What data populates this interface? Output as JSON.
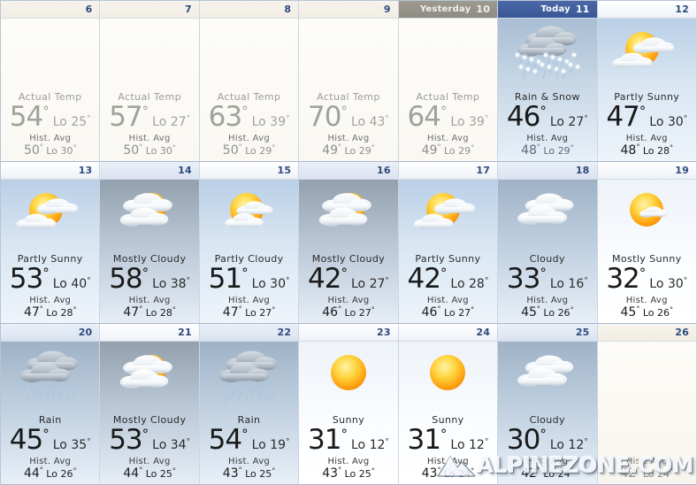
{
  "watermark": {
    "text": "ALPINEZONE.COM",
    "icon": "mountain-logo-icon"
  },
  "labels": {
    "actual_temp": "Actual Temp",
    "hist_avg": "Hist. Avg",
    "lo": "Lo",
    "degree": "°",
    "today": "Today",
    "yesterday": "Yesterday"
  },
  "colors": {
    "today_header_bg": "#3a5795",
    "yesterday_header_bg": "#8e8b82",
    "past_header_bg": "#f2eee5",
    "future_header_bg": "#eef2f8",
    "header_text": "#2e4a7d",
    "sun": "#ffc20a",
    "cloud": "#e8edf2",
    "rain": "#9fc3de"
  },
  "weeks": [
    {
      "days": [
        {
          "num": "6",
          "prefix": "",
          "state": "past",
          "icon": "none",
          "cond": "Actual Temp",
          "hi": "54",
          "lo": "25",
          "avg_hi": "50",
          "avg_lo": "30"
        },
        {
          "num": "7",
          "prefix": "",
          "state": "past",
          "icon": "none",
          "cond": "Actual Temp",
          "hi": "57",
          "lo": "27",
          "avg_hi": "50",
          "avg_lo": "30"
        },
        {
          "num": "8",
          "prefix": "",
          "state": "past",
          "icon": "none",
          "cond": "Actual Temp",
          "hi": "63",
          "lo": "39",
          "avg_hi": "50",
          "avg_lo": "29"
        },
        {
          "num": "9",
          "prefix": "",
          "state": "past",
          "icon": "none",
          "cond": "Actual Temp",
          "hi": "70",
          "lo": "43",
          "avg_hi": "49",
          "avg_lo": "29"
        },
        {
          "num": "10",
          "prefix": "Yesterday",
          "state": "yesterday",
          "icon": "none",
          "cond": "Actual Temp",
          "hi": "64",
          "lo": "39",
          "avg_hi": "49",
          "avg_lo": "29"
        },
        {
          "num": "11",
          "prefix": "Today",
          "state": "today",
          "icon": "rain-snow",
          "cond": "Rain & Snow",
          "hi": "46",
          "lo": "27",
          "avg_hi": "48",
          "avg_lo": "29"
        },
        {
          "num": "12",
          "prefix": "",
          "state": "future",
          "icon": "partly-sunny",
          "cond": "Partly Sunny",
          "hi": "47",
          "lo": "30",
          "avg_hi": "48",
          "avg_lo": "28"
        }
      ]
    },
    {
      "days": [
        {
          "num": "13",
          "prefix": "",
          "state": "future",
          "icon": "partly-sunny",
          "cond": "Partly Sunny",
          "hi": "53",
          "lo": "40",
          "avg_hi": "47",
          "avg_lo": "28"
        },
        {
          "num": "14",
          "prefix": "",
          "state": "future-b",
          "icon": "mostly-cloudy",
          "cond": "Mostly Cloudy",
          "hi": "58",
          "lo": "38",
          "avg_hi": "47",
          "avg_lo": "28"
        },
        {
          "num": "15",
          "prefix": "",
          "state": "future",
          "icon": "partly-cloudy",
          "cond": "Partly Cloudy",
          "hi": "51",
          "lo": "30",
          "avg_hi": "47",
          "avg_lo": "27"
        },
        {
          "num": "16",
          "prefix": "",
          "state": "future-b",
          "icon": "mostly-cloudy",
          "cond": "Mostly Cloudy",
          "hi": "42",
          "lo": "27",
          "avg_hi": "46",
          "avg_lo": "27"
        },
        {
          "num": "17",
          "prefix": "",
          "state": "future",
          "icon": "partly-sunny",
          "cond": "Partly Sunny",
          "hi": "42",
          "lo": "28",
          "avg_hi": "46",
          "avg_lo": "27"
        },
        {
          "num": "18",
          "prefix": "",
          "state": "future-b",
          "icon": "cloudy",
          "cond": "Cloudy",
          "hi": "33",
          "lo": "16",
          "avg_hi": "45",
          "avg_lo": "26"
        },
        {
          "num": "19",
          "prefix": "",
          "state": "future",
          "icon": "mostly-sunny",
          "cond": "Mostly Sunny",
          "hi": "32",
          "lo": "30",
          "avg_hi": "45",
          "avg_lo": "26"
        }
      ]
    },
    {
      "days": [
        {
          "num": "20",
          "prefix": "",
          "state": "future-b",
          "icon": "rain",
          "cond": "Rain",
          "hi": "45",
          "lo": "35",
          "avg_hi": "44",
          "avg_lo": "26"
        },
        {
          "num": "21",
          "prefix": "",
          "state": "future",
          "icon": "mostly-cloudy",
          "cond": "Mostly Cloudy",
          "hi": "53",
          "lo": "34",
          "avg_hi": "44",
          "avg_lo": "25"
        },
        {
          "num": "22",
          "prefix": "",
          "state": "future-b",
          "icon": "rain",
          "cond": "Rain",
          "hi": "54",
          "lo": "19",
          "avg_hi": "43",
          "avg_lo": "25"
        },
        {
          "num": "23",
          "prefix": "",
          "state": "future",
          "icon": "sunny",
          "cond": "Sunny",
          "hi": "31",
          "lo": "12",
          "avg_hi": "43",
          "avg_lo": "25"
        },
        {
          "num": "24",
          "prefix": "",
          "state": "future",
          "icon": "sunny",
          "cond": "Sunny",
          "hi": "31",
          "lo": "12",
          "avg_hi": "43",
          "avg_lo": "24"
        },
        {
          "num": "25",
          "prefix": "",
          "state": "future-b",
          "icon": "cloudy",
          "cond": "Cloudy",
          "hi": "30",
          "lo": "12",
          "avg_hi": "42",
          "avg_lo": "24"
        },
        {
          "num": "26",
          "prefix": "",
          "state": "empty",
          "icon": "none",
          "cond": "",
          "hi": "",
          "lo": "",
          "avg_hi": "42",
          "avg_lo": "24"
        }
      ]
    }
  ]
}
